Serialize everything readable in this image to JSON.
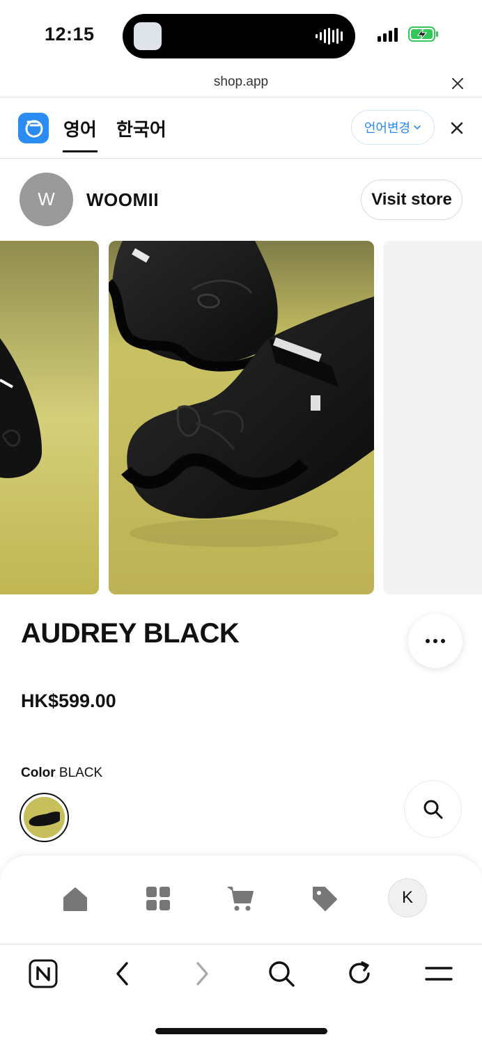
{
  "status_bar": {
    "time": "12:15"
  },
  "browser": {
    "url": "shop.app"
  },
  "translate_bar": {
    "tab_source": "영어",
    "tab_target": "한국어",
    "change_language": "언어변경"
  },
  "store": {
    "avatar_initial": "W",
    "name": "WOOMII",
    "visit_label": "Visit store"
  },
  "product": {
    "title": "AUDREY BLACK",
    "price": "HK$599.00",
    "color_label": "Color",
    "color_value": "BLACK",
    "image_background": "#c5bd55"
  },
  "shop_nav": {
    "items": [
      "home-icon",
      "categories-icon",
      "cart-icon",
      "tag-icon"
    ],
    "profile_initial": "K"
  },
  "browser_toolbar": {
    "items": [
      "n-logo-icon",
      "back-icon",
      "forward-icon",
      "search-icon",
      "reload-icon",
      "menu-icon"
    ]
  },
  "colors": {
    "accent": "#2a8cf0",
    "text": "#111111",
    "battery_charging": "#34c759"
  }
}
